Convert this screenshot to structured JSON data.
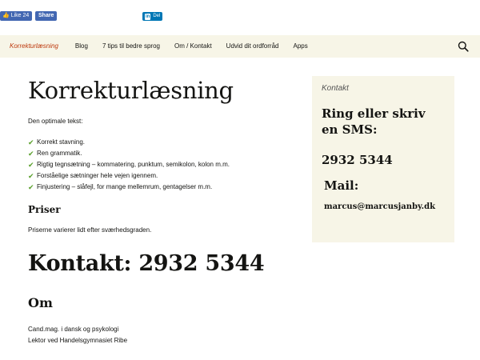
{
  "social": {
    "fb_like_label": "Like 24",
    "fb_share_label": "Share",
    "li_logo": "in",
    "li_share_label": "Del"
  },
  "nav": {
    "items": [
      {
        "label": "Korrekturlæsning",
        "active": true
      },
      {
        "label": "Blog"
      },
      {
        "label": "7 tips til bedre sprog"
      },
      {
        "label": "Om / Kontakt"
      },
      {
        "label": "Udvid dit ordforråd"
      },
      {
        "label": "Apps"
      }
    ],
    "search_icon": "search-icon"
  },
  "main": {
    "title": "Korrekturlæsning",
    "intro": "Den optimale tekst:",
    "checks": [
      "Korrekt stavning.",
      "Ren grammatik.",
      "Rigtig tegnsætning – kommatering, punktum, semikolon, kolon m.m.",
      "Forståelige sætninger hele vejen igennem.",
      "Finjustering – slåfejl, for mange mellemrum, gentagelser m.m."
    ],
    "priser_heading": "Priser",
    "priser_text": "Priserne varierer lidt efter sværhedsgraden.",
    "kontakt_heading": "Kontakt: 2932 5344",
    "om_heading": "Om",
    "om_lines": [
      "Cand.mag. i dansk og psykologi",
      "Lektor ved Handelsgymnasiet Ribe"
    ]
  },
  "sidebar": {
    "label": "Kontakt",
    "heading": "Ring eller skriv en SMS:",
    "phone": "2932 5344",
    "mail_heading": "Mail:",
    "mail": "marcus@marcusjanby.dk"
  },
  "colors": {
    "accent": "#bc360a",
    "nav_bg": "#f7f5e7",
    "check": "#5aa02c",
    "facebook": "#4267b2",
    "linkedin": "#0077b5"
  }
}
